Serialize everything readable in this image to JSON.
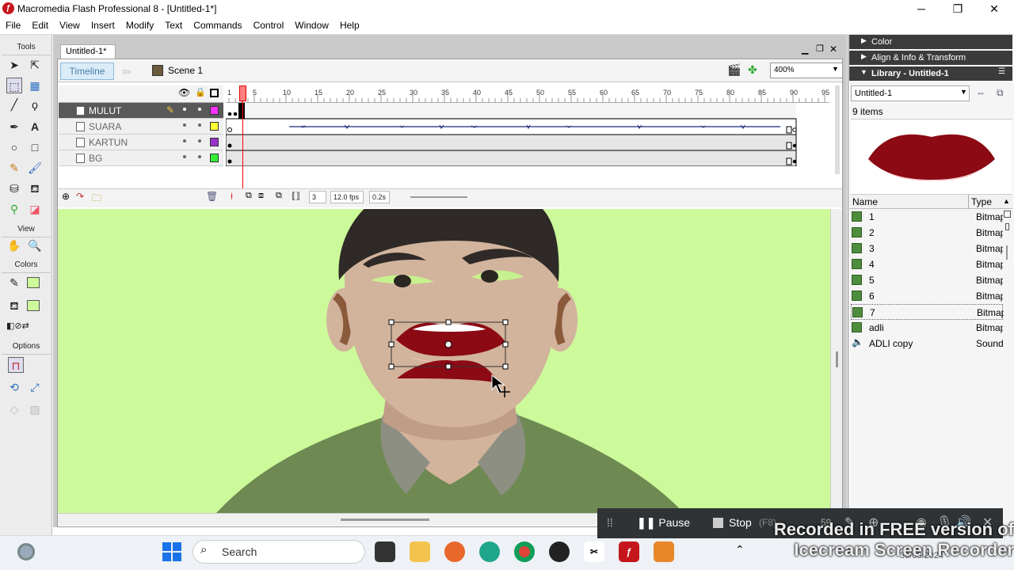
{
  "window": {
    "title": "Macromedia Flash Professional 8 - [Untitled-1*]",
    "minimize": "─",
    "maximize": "❐",
    "close": "✕"
  },
  "menu": [
    "File",
    "Edit",
    "View",
    "Insert",
    "Modify",
    "Text",
    "Commands",
    "Control",
    "Window",
    "Help"
  ],
  "tools": {
    "header": "Tools",
    "view_header": "View",
    "colors_header": "Colors",
    "options_header": "Options"
  },
  "document": {
    "tab": "Untitled-1*",
    "timeline_button": "Timeline",
    "scene": "Scene 1",
    "zoom": "400%",
    "layers": [
      {
        "name": "MULUT",
        "color": "#ff33ff",
        "active": true
      },
      {
        "name": "SUARA",
        "color": "#ffff33",
        "active": false
      },
      {
        "name": "KARTUN",
        "color": "#9933cc",
        "active": false
      },
      {
        "name": "BG",
        "color": "#33ee33",
        "active": false
      }
    ],
    "ruler": [
      "1",
      "5",
      "10",
      "15",
      "20",
      "25",
      "30",
      "35",
      "40",
      "45",
      "50",
      "55",
      "60",
      "65",
      "70",
      "75",
      "80",
      "85",
      "90",
      "95"
    ],
    "current_frame": "3",
    "fps": "12.0 fps",
    "time": "0.2s"
  },
  "panels": {
    "color": "Color",
    "align": "Align & Info & Transform",
    "library": "Library - Untitled-1",
    "library_select": "Untitled-1",
    "items_count": "9 items",
    "col_name": "Name",
    "col_type": "Type",
    "items": [
      {
        "name": "1",
        "type": "Bitmap",
        "icon": "bitmap-icon"
      },
      {
        "name": "2",
        "type": "Bitmap",
        "icon": "bitmap-icon"
      },
      {
        "name": "3",
        "type": "Bitmap",
        "icon": "bitmap-icon"
      },
      {
        "name": "4",
        "type": "Bitmap",
        "icon": "bitmap-icon"
      },
      {
        "name": "5",
        "type": "Bitmap",
        "icon": "bitmap-icon"
      },
      {
        "name": "6",
        "type": "Bitmap",
        "icon": "bitmap-icon"
      },
      {
        "name": "7",
        "type": "Bitmap",
        "icon": "bitmap-icon"
      },
      {
        "name": "adli",
        "type": "Bitmap",
        "icon": "bitmap-icon"
      },
      {
        "name": "ADLI copy",
        "type": "Sound",
        "icon": "sound-icon"
      }
    ]
  },
  "taskbar": {
    "search_placeholder": "Search",
    "date": "30/05/2024"
  },
  "recorder": {
    "pause": "Pause",
    "stop": "Stop",
    "stop_key": "(F8)",
    "counter": "59"
  },
  "watermark": {
    "line1": "Recorded in FREE version of",
    "line2": "Icecream Screen Recorder"
  },
  "colors": {
    "stage": "#ccfa9a",
    "accent_playhead": "#ff0000",
    "lip": "#8b0a14"
  }
}
